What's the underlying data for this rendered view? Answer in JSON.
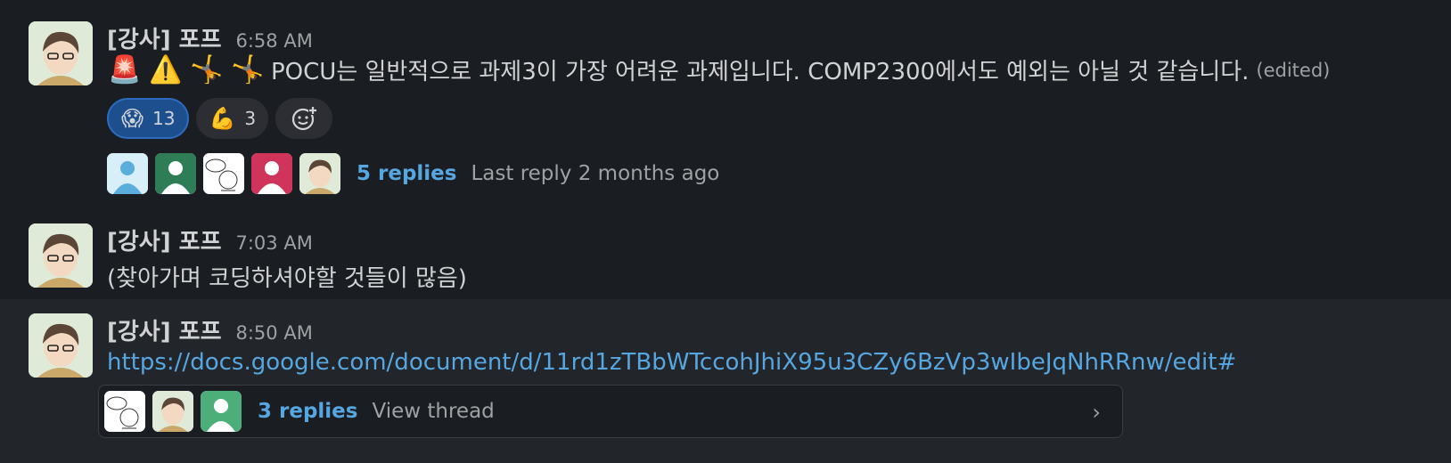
{
  "messages": [
    {
      "author": "[강사] 포프",
      "time": "6:58 AM",
      "emoji": [
        "🚨",
        "⚠️",
        "🤸",
        "🤸"
      ],
      "text": "POCU는 일반적으로 과제3이 가장 어려운 과제입니다. COMP2300에서도 예외는 아닐 것 같습니다.",
      "edited": "(edited)",
      "reactions": [
        {
          "emoji": "😱",
          "count": "13",
          "mine": true
        },
        {
          "emoji": "💪",
          "count": "3",
          "mine": false
        }
      ],
      "thread": {
        "replies": "5 replies",
        "last": "Last reply 2 months ago"
      }
    },
    {
      "author": "[강사] 포프",
      "time": "7:03 AM",
      "text": "(찾아가며 코딩하셔야할 것들이 많음)"
    },
    {
      "author": "[강사] 포프",
      "time": "8:50 AM",
      "link": "https://docs.google.com/document/d/11rd1zTBbWTccohJhiX95u3CZy6BzVp3wIbeJqNhRRnw/edit#",
      "thread": {
        "replies": "3 replies",
        "last": "View thread"
      }
    }
  ],
  "colors": {
    "link": "#56a7e1",
    "bg": "#1a1d21",
    "hover": "#222529"
  }
}
